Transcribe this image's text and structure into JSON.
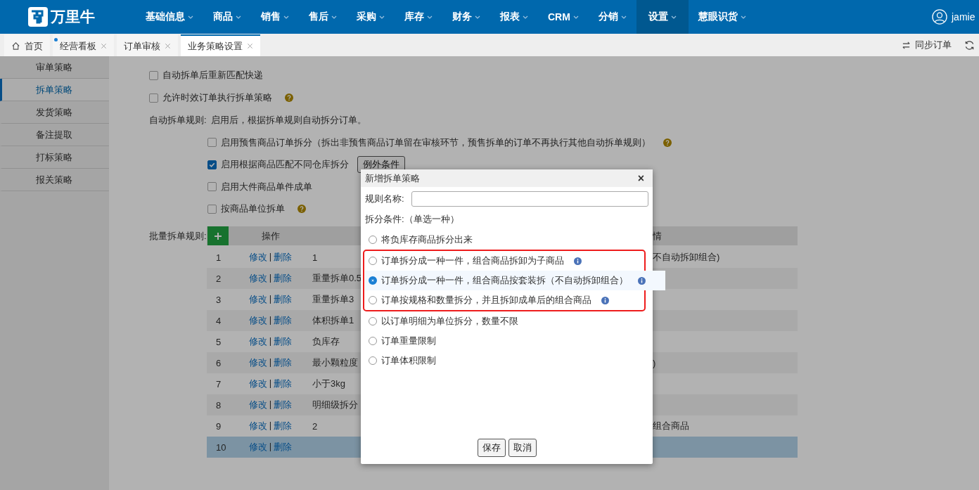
{
  "nav": {
    "logo": "万里牛",
    "user": "jamie",
    "items": [
      {
        "label": "基础信息",
        "selected": false
      },
      {
        "label": "商品",
        "selected": false
      },
      {
        "label": "销售",
        "selected": false
      },
      {
        "label": "售后",
        "selected": false
      },
      {
        "label": "采购",
        "selected": false
      },
      {
        "label": "库存",
        "selected": false
      },
      {
        "label": "财务",
        "selected": false
      },
      {
        "label": "报表",
        "selected": false
      },
      {
        "label": "CRM",
        "selected": false
      },
      {
        "label": "分销",
        "selected": false
      },
      {
        "label": "设置",
        "selected": true
      },
      {
        "label": "慧眼识货",
        "selected": false
      }
    ]
  },
  "tabs": [
    {
      "label": "首页",
      "selected": false,
      "kind": "home",
      "dot": false
    },
    {
      "label": "经营看板",
      "selected": false,
      "kind": "closable",
      "dot": true
    },
    {
      "label": "订单审核",
      "selected": false,
      "kind": "closable",
      "dot": false
    },
    {
      "label": "业务策略设置",
      "selected": true,
      "kind": "closable",
      "dot": false
    }
  ],
  "toolbar": {
    "sync": "同步订单"
  },
  "sidebar": [
    {
      "label": "审单策略",
      "selected": false
    },
    {
      "label": "拆单策略",
      "selected": true
    },
    {
      "label": "发货策略",
      "selected": false
    },
    {
      "label": "备注提取",
      "selected": false
    },
    {
      "label": "打标策略",
      "selected": false
    },
    {
      "label": "报关策略",
      "selected": false
    }
  ],
  "options": [
    {
      "label": "自动拆单后重新匹配快递",
      "checked": false,
      "help": false
    },
    {
      "label": "允许时效订单执行拆单策略",
      "checked": false,
      "help": true
    }
  ],
  "auto_rule": {
    "label": "自动拆单规则:",
    "text": "启用后，根据拆单规则自动拆分订单。",
    "options": [
      {
        "label": "启用预售商品订单拆分（拆出非预售商品订单留在审核环节，预售拆单的订单不再执行其他自动拆单规则）",
        "checked": false,
        "help": true
      },
      {
        "label": "启用根据商品匹配不同仓库拆分",
        "checked": true,
        "help": false,
        "button": "例外条件"
      },
      {
        "label": "启用大件商品单件成单",
        "checked": false,
        "help": false
      },
      {
        "label": "按商品单位拆单",
        "checked": false,
        "help": true
      }
    ]
  },
  "batch": {
    "label": "批量拆单规则:",
    "columns": [
      "操作",
      "情"
    ],
    "rows": [
      {
        "no": "1",
        "edit": "修改",
        "separator": "|",
        "delete": "删除",
        "name": "1",
        "detail": "不自动拆卸组合)",
        "selected": false
      },
      {
        "no": "2",
        "edit": "修改",
        "separator": "|",
        "delete": "删除",
        "name": "重量拆单0.5",
        "selected": false
      },
      {
        "no": "3",
        "edit": "修改",
        "separator": "|",
        "delete": "删除",
        "name": "重量拆单3",
        "selected": false
      },
      {
        "no": "4",
        "edit": "修改",
        "separator": "|",
        "delete": "删除",
        "name": "体积拆单1",
        "selected": false
      },
      {
        "no": "5",
        "edit": "修改",
        "separator": "|",
        "delete": "删除",
        "name": "负库存",
        "selected": false
      },
      {
        "no": "6",
        "edit": "修改",
        "separator": "|",
        "delete": "删除",
        "name": "最小颗粒度",
        "detail": ")",
        "selected": false
      },
      {
        "no": "7",
        "edit": "修改",
        "separator": "|",
        "delete": "删除",
        "name": "小于3kg",
        "selected": false
      },
      {
        "no": "8",
        "edit": "修改",
        "separator": "|",
        "delete": "删除",
        "name": "明细级拆分",
        "selected": false
      },
      {
        "no": "9",
        "edit": "修改",
        "separator": "|",
        "delete": "删除",
        "name": "2",
        "detail": "组合商品",
        "selected": false
      },
      {
        "no": "10",
        "edit": "修改",
        "separator": "|",
        "delete": "删除",
        "selected": true
      }
    ]
  },
  "dialog": {
    "title": "新增拆单策略",
    "close": "×",
    "name_label": "规则名称:",
    "condition_label": "拆分条件:（单选一种）",
    "options": [
      {
        "label": "将负库存商品拆分出来",
        "selected": false,
        "info": false,
        "highlighted": false,
        "hovered": false
      },
      {
        "label": "订单拆分成一种一件，组合商品拆卸为子商品",
        "selected": false,
        "info": true,
        "highlighted": true,
        "hovered": false
      },
      {
        "label": "订单拆分成一种一件，组合商品按套装拆（不自动拆卸组合）",
        "selected": true,
        "info": true,
        "highlighted": true,
        "hovered": true
      },
      {
        "label": "订单按规格和数量拆分，并且拆卸成单后的组合商品",
        "selected": false,
        "info": true,
        "highlighted": true,
        "hovered": false
      },
      {
        "label": "以订单明细为单位拆分，数量不限",
        "selected": false,
        "info": false,
        "highlighted": false,
        "hovered": false
      },
      {
        "label": "订单重量限制",
        "selected": false,
        "info": false,
        "highlighted": false,
        "hovered": false
      },
      {
        "label": "订单体积限制",
        "selected": false,
        "info": false,
        "highlighted": false,
        "hovered": false
      }
    ],
    "buttons": [
      "保存",
      "取消"
    ]
  }
}
